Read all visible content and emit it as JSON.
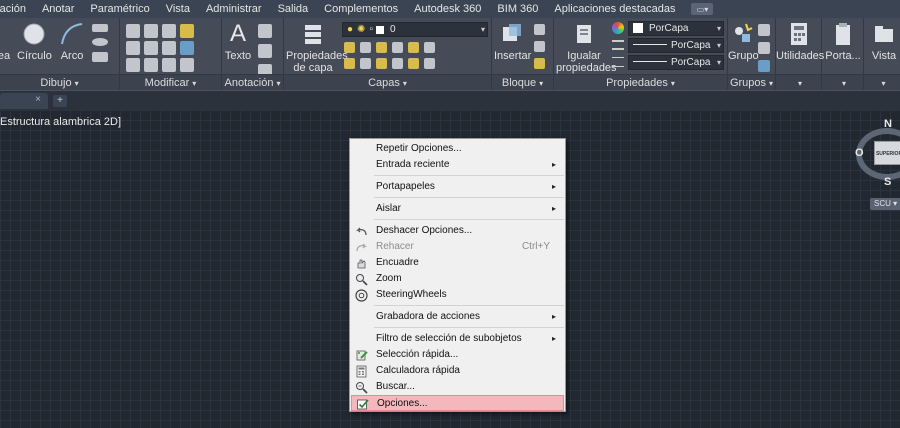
{
  "menubar": {
    "items": [
      "ración",
      "Anotar",
      "Paramétrico",
      "Vista",
      "Administrar",
      "Salida",
      "Complementos",
      "Autodesk 360",
      "BIM 360",
      "Aplicaciones destacadas"
    ]
  },
  "ribbon": {
    "panels": {
      "dibujo": {
        "title": "Dibujo",
        "btn_area": "ea",
        "btn_circle": "Círculo",
        "btn_arc": "Arco"
      },
      "modificar": {
        "title": "Modificar"
      },
      "anotacion": {
        "title": "Anotación",
        "btn_text": "Texto"
      },
      "capas": {
        "title": "Capas",
        "btn_layer_props_1": "Propiedades",
        "btn_layer_props_2": "de capa",
        "layer_combo_value": "0"
      },
      "bloque": {
        "title": "Bloque",
        "btn_insert": "Insertar"
      },
      "propiedades": {
        "title": "Propiedades",
        "btn_match_1": "Igualar",
        "btn_match_2": "propiedades",
        "color_value": "PorCapa",
        "linetype_value": "PorCapa",
        "lineweight_value": "PorCapa"
      },
      "grupos": {
        "title": "Grupos",
        "btn_group": "Grupo"
      },
      "utilidades": {
        "btn": "Utilidades"
      },
      "portapapeles": {
        "btn": "Porta..."
      },
      "vista": {
        "btn": "Vista"
      }
    },
    "accent_color": "#6fa6d6"
  },
  "tabs": {
    "doc_close": "×",
    "add": "+"
  },
  "viewport": {
    "label": "Estructura alambrica 2D]"
  },
  "viewcube": {
    "north": "N",
    "south": "S",
    "west": "O",
    "face": "SUPERIOR",
    "ucs": "SCU"
  },
  "context_menu": {
    "items": [
      {
        "label": "Repetir Opciones...",
        "icon": "none"
      },
      {
        "label": "Entrada reciente",
        "submenu": "▸"
      },
      {
        "label": "Portapapeles",
        "submenu": "▸"
      },
      {
        "label": "Aislar",
        "submenu": "▸"
      },
      {
        "label": "Deshacer Opciones...",
        "icon": "undo-icon"
      },
      {
        "label": "Rehacer",
        "shortcut": "Ctrl+Y",
        "icon": "redo-icon",
        "disabled": true
      },
      {
        "label": "Encuadre",
        "icon": "pan-icon"
      },
      {
        "label": "Zoom",
        "icon": "zoom-icon"
      },
      {
        "label": "SteeringWheels",
        "icon": "steeringwheels-icon"
      },
      {
        "label": "Grabadora de acciones",
        "submenu": "▸"
      },
      {
        "label": "Filtro de selección de subobjetos",
        "submenu": "▸"
      },
      {
        "label": "Selección rápida...",
        "icon": "quick-select-icon"
      },
      {
        "label": "Calculadora rápida",
        "icon": "calculator-icon"
      },
      {
        "label": "Buscar...",
        "icon": "find-icon"
      },
      {
        "label": "Opciones...",
        "icon": "options-icon",
        "highlighted": true
      }
    ],
    "highlight_color": "#f3b7bc"
  }
}
